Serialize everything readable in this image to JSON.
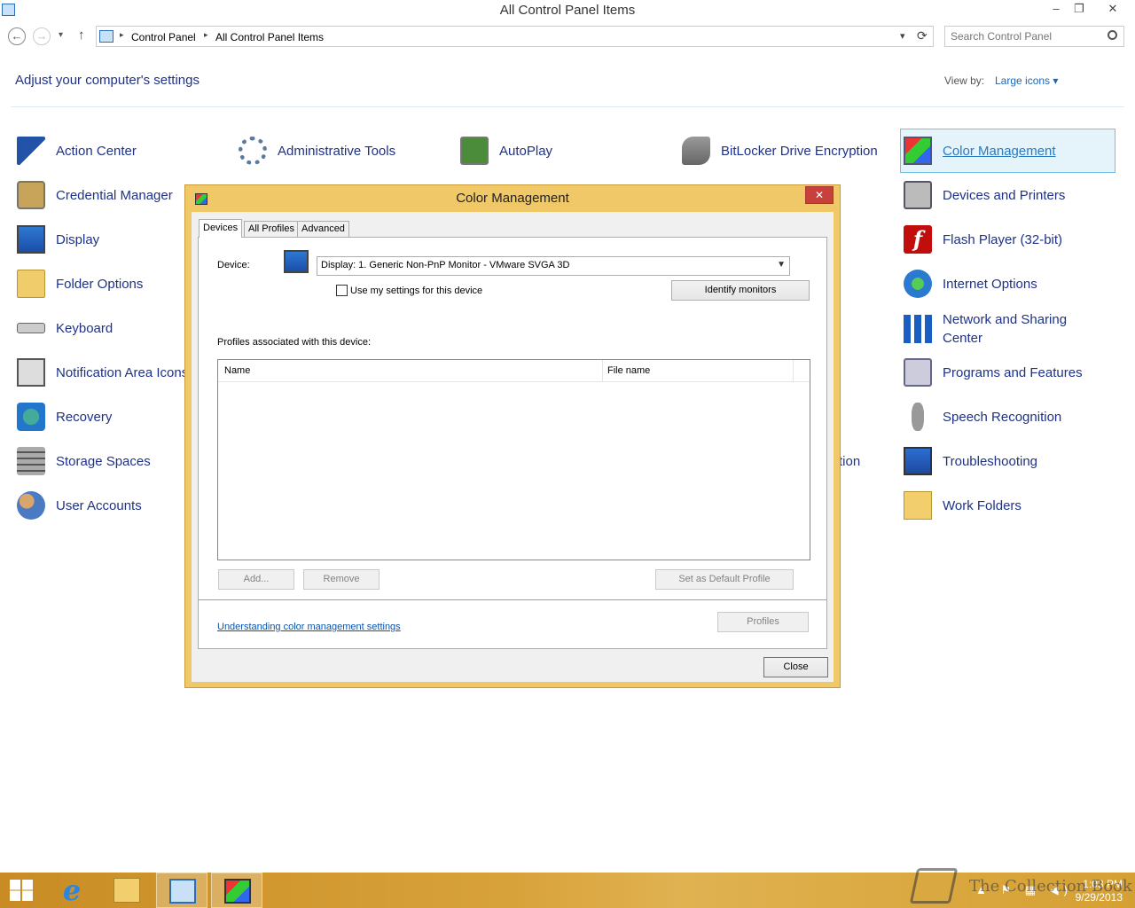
{
  "window": {
    "title": "All Control Panel Items",
    "minimize": "–",
    "maximize": "❐",
    "close": "✕"
  },
  "nav": {
    "back": "←",
    "forward": "→",
    "recent": "▾",
    "up": "↑",
    "breadcrumb": [
      "Control Panel",
      "All Control Panel Items"
    ],
    "sep": "▸",
    "dropdown": "▾",
    "refresh": "⟳",
    "search_placeholder": "Search Control Panel"
  },
  "page": {
    "heading": "Adjust your computer's settings",
    "view_by_label": "View by:",
    "view_mode": "Large icons ▾"
  },
  "items": {
    "action_center": "Action Center",
    "administrative_tools": "Administrative Tools",
    "autoplay": "AutoPlay",
    "bitlocker": "BitLocker Drive Encryption",
    "color_management": "Color Management",
    "credential_manager": "Credential Manager",
    "devices_printers": "Devices and Printers",
    "display": "Display",
    "flash_player": "Flash Player (32-bit)",
    "folder_options": "Folder Options",
    "internet_options": "Internet Options",
    "keyboard": "Keyboard",
    "network_sharing": "Network and Sharing Center",
    "notification_area": "Notification Area Icons",
    "programs_features": "Programs and Features",
    "recovery": "Recovery",
    "speech_recognition": "Speech Recognition",
    "storage_spaces": "Storage Spaces",
    "partial_item": "tion",
    "troubleshooting": "Troubleshooting",
    "user_accounts": "User Accounts",
    "work_folders": "Work Folders"
  },
  "dialog": {
    "title": "Color Management",
    "close_glyph": "✕",
    "tabs": [
      "Devices",
      "All Profiles",
      "Advanced"
    ],
    "device_label": "Device:",
    "device_value": "Display: 1. Generic Non-PnP Monitor - VMware SVGA 3D",
    "dropdown_arrow": "▼",
    "use_my_settings": "Use my settings for this device",
    "identify_monitors": "Identify monitors",
    "profiles_label": "Profiles associated with this device:",
    "columns": [
      "Name",
      "File name"
    ],
    "add": "Add...",
    "remove": "Remove",
    "set_default": "Set as Default Profile",
    "help_link": "Understanding color management settings",
    "profiles_button": "Profiles",
    "close_button": "Close"
  },
  "taskbar": {
    "tray_icons": "▲ ⚑ ▦ ◀)",
    "time": "1:03 PM",
    "date": "9/29/2013",
    "watermark": "The Collection Book"
  }
}
